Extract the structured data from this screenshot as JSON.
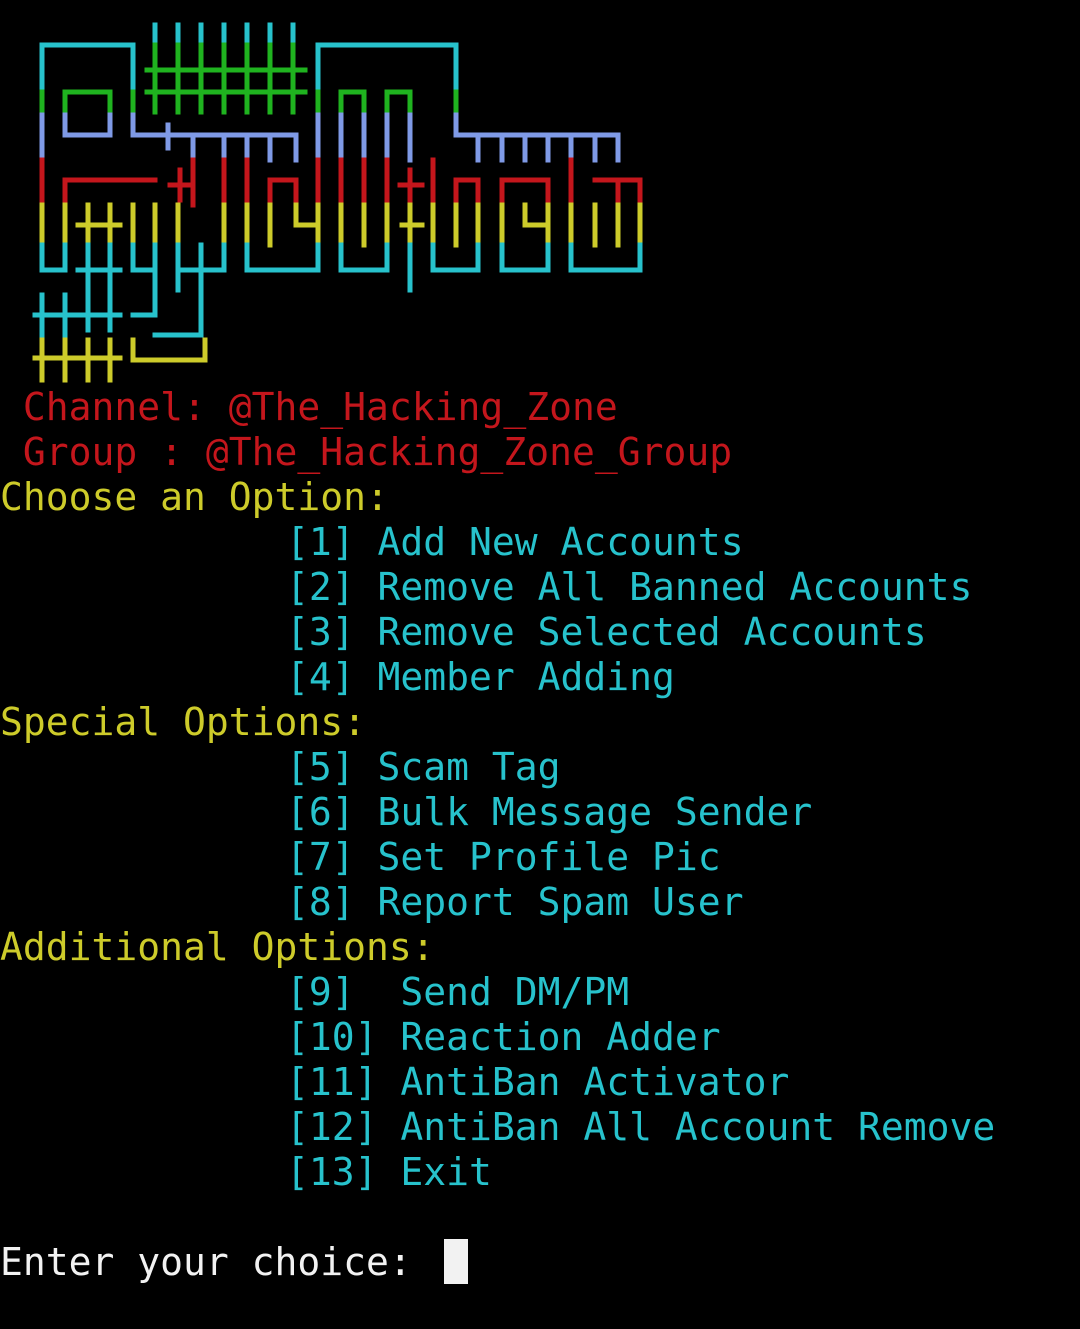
{
  "colors": {
    "background": "#000000",
    "red": "#c4161c",
    "yellow": "#cdcb2a",
    "cyan": "#27c2cc",
    "white": "#f2f2f2",
    "green": "#1fb31f",
    "blue": "#7f9ae6"
  },
  "banner": {
    "icon": "ascii-art-logo"
  },
  "info": {
    "channel": " Channel: @The_Hacking_Zone",
    "group": " Group : @The_Hacking_Zone_Group"
  },
  "sections": {
    "choose": "Choose an Option:",
    "special": "Special Options:",
    "additional": "Additional Options:"
  },
  "options": [
    {
      "num": "[1]",
      "label": " Add New Accounts"
    },
    {
      "num": "[2]",
      "label": " Remove All Banned Accounts"
    },
    {
      "num": "[3]",
      "label": " Remove Selected Accounts"
    },
    {
      "num": "[4]",
      "label": " Member Adding"
    },
    {
      "num": "[5]",
      "label": " Scam Tag"
    },
    {
      "num": "[6]",
      "label": " Bulk Message Sender"
    },
    {
      "num": "[7]",
      "label": " Set Profile Pic"
    },
    {
      "num": "[8]",
      "label": " Report Spam User"
    },
    {
      "num": "[9]",
      "label": "  Send DM/PM"
    },
    {
      "num": "[10]",
      "label": " Reaction Adder"
    },
    {
      "num": "[11]",
      "label": " AntiBan Activator"
    },
    {
      "num": "[12]",
      "label": " AntiBan All Account Remove"
    },
    {
      "num": "[13]",
      "label": " Exit"
    }
  ],
  "prompt": {
    "text": "Enter your choice: "
  }
}
